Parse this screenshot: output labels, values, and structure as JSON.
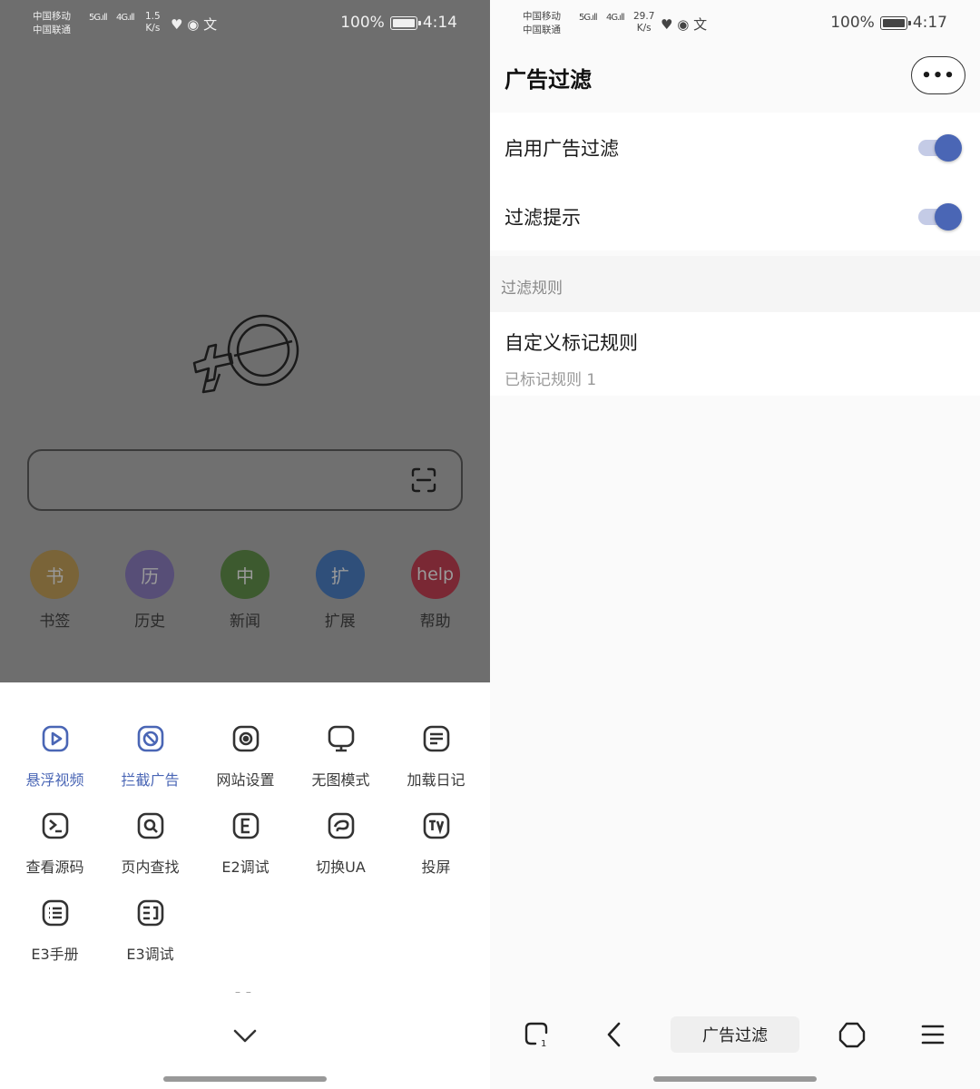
{
  "left": {
    "status": {
      "carrier1": "中国移动",
      "carrier2": "中国联通",
      "sig1": "5G",
      "sig2": "4G",
      "speed_value": "1.5",
      "speed_unit": "K/s",
      "battery": "100%",
      "time": "4:14"
    },
    "shortcuts": [
      {
        "glyph": "书",
        "label": "书签",
        "color": "#7a6438"
      },
      {
        "glyph": "历",
        "label": "历史",
        "color": "#574e77"
      },
      {
        "glyph": "中",
        "label": "新闻",
        "color": "#3d5a2f"
      },
      {
        "glyph": "扩",
        "label": "扩展",
        "color": "#2f4f7a"
      },
      {
        "glyph": "help",
        "label": "帮助",
        "color": "#7a2834"
      }
    ],
    "menu": [
      {
        "label": "悬浮视频",
        "icon": "play-icon",
        "active": true
      },
      {
        "label": "拦截广告",
        "icon": "block-icon",
        "active": true
      },
      {
        "label": "网站设置",
        "icon": "site-settings-icon",
        "active": false
      },
      {
        "label": "无图模式",
        "icon": "monitor-icon",
        "active": false
      },
      {
        "label": "加载日记",
        "icon": "log-icon",
        "active": false
      },
      {
        "label": "查看源码",
        "icon": "terminal-icon",
        "active": false
      },
      {
        "label": "页内查找",
        "icon": "find-icon",
        "active": false
      },
      {
        "label": "E2调试",
        "icon": "e2-icon",
        "active": false
      },
      {
        "label": "切换UA",
        "icon": "switch-ua-icon",
        "active": false
      },
      {
        "label": "投屏",
        "icon": "cast-tv-icon",
        "active": false
      },
      {
        "label": "E3手册",
        "icon": "manual-icon",
        "active": false
      },
      {
        "label": "E3调试",
        "icon": "e3-debug-icon",
        "active": false
      }
    ],
    "drag_dash": "– –"
  },
  "right": {
    "status": {
      "carrier1": "中国移动",
      "carrier2": "中国联通",
      "sig1": "5G",
      "sig2": "4G",
      "speed_value": "29.7",
      "speed_unit": "K/s",
      "battery": "100%",
      "time": "4:17"
    },
    "title": "广告过滤",
    "more_label": "•••",
    "settings": [
      {
        "label": "启用广告过滤",
        "on": true
      },
      {
        "label": "过滤提示",
        "on": true
      }
    ],
    "section": "过滤规则",
    "rule": {
      "title": "自定义标记规则",
      "subtitle": "已标记规则 1"
    },
    "bottom_title": "广告过滤"
  },
  "colors": {
    "accent": "#4a66b5",
    "dim_overlay": "#6e6e6e"
  }
}
